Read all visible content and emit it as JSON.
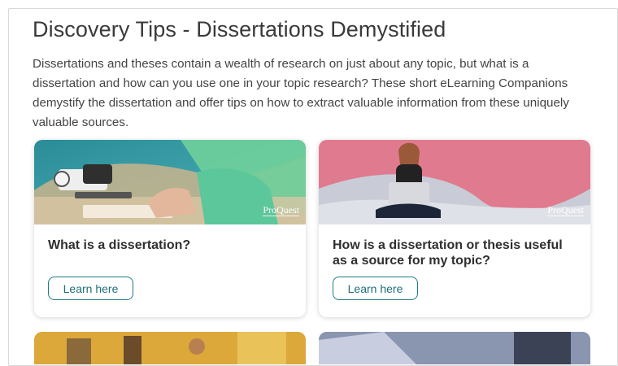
{
  "page": {
    "title": "Discovery Tips - Dissertations Demystified",
    "intro": "Dissertations and theses contain a wealth of research on just about any topic, but what is a dissertation and how can you use one in your topic research? These short eLearning Companions demystify the dissertation and offer tips on how to extract valuable information from these uniquely valuable sources."
  },
  "cards": [
    {
      "heading": "What is a dissertation?",
      "button": "Learn here",
      "logo": "ProQuest"
    },
    {
      "heading": "How is a dissertation or thesis useful as a source for my topic?",
      "button": "Learn here",
      "logo": "ProQuest"
    }
  ],
  "colors": {
    "accent": "#1e7b85",
    "card1_bg": "#3a9aa3",
    "card2_bg": "#e0768a"
  }
}
